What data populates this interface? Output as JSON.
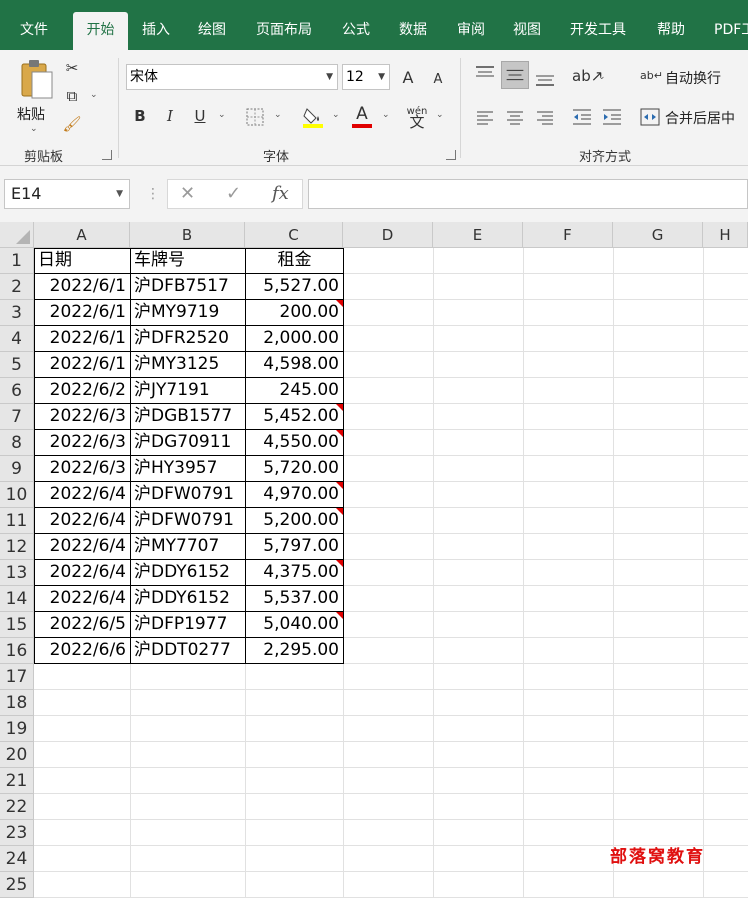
{
  "ribbon_tabs": [
    {
      "label": "文件"
    },
    {
      "label": "开始"
    },
    {
      "label": "插入"
    },
    {
      "label": "绘图"
    },
    {
      "label": "页面布局"
    },
    {
      "label": "公式"
    },
    {
      "label": "数据"
    },
    {
      "label": "审阅"
    },
    {
      "label": "视图"
    },
    {
      "label": "开发工具"
    },
    {
      "label": "帮助"
    },
    {
      "label": "PDF工"
    }
  ],
  "active_tab": "开始",
  "clipboard": {
    "paste_label": "粘贴",
    "group_label": "剪贴板"
  },
  "font": {
    "name": "宋体",
    "size": "12",
    "group_label": "字体",
    "bold": "B",
    "italic": "I",
    "underline": "U",
    "font_color_glyph": "A",
    "phonetic_glyph": "wén",
    "grow_glyph": "A",
    "shrink_glyph": "A"
  },
  "alignment": {
    "wrap_text_label": "自动换行",
    "merge_center_label": "合并后居中",
    "group_label": "对齐方式"
  },
  "formula_bar": {
    "name_box": "E14",
    "fx": "fx",
    "cancel": "✕",
    "enter": "✓",
    "value": ""
  },
  "columns": [
    "A",
    "B",
    "C",
    "D",
    "E",
    "F",
    "G",
    "H"
  ],
  "rows": [
    "1",
    "2",
    "3",
    "4",
    "5",
    "6",
    "7",
    "8",
    "9",
    "10",
    "11",
    "12",
    "13",
    "14",
    "15",
    "16",
    "17",
    "18",
    "19",
    "20",
    "21",
    "22",
    "23",
    "24",
    "25"
  ],
  "table": {
    "headers": [
      "日期",
      "车牌号",
      "租金"
    ],
    "data": [
      {
        "date": "2022/6/1",
        "plate": "沪DFB7517",
        "rent": "5,527.00",
        "comment": false
      },
      {
        "date": "2022/6/1",
        "plate": "沪MY9719",
        "rent": "200.00",
        "comment": true
      },
      {
        "date": "2022/6/1",
        "plate": "沪DFR2520",
        "rent": "2,000.00",
        "comment": false
      },
      {
        "date": "2022/6/1",
        "plate": "沪MY3125",
        "rent": "4,598.00",
        "comment": false
      },
      {
        "date": "2022/6/2",
        "plate": "沪JY7191",
        "rent": "245.00",
        "comment": false
      },
      {
        "date": "2022/6/3",
        "plate": "沪DGB1577",
        "rent": "5,452.00",
        "comment": true
      },
      {
        "date": "2022/6/3",
        "plate": "沪DG70911",
        "rent": "4,550.00",
        "comment": true
      },
      {
        "date": "2022/6/3",
        "plate": "沪HY3957",
        "rent": "5,720.00",
        "comment": false
      },
      {
        "date": "2022/6/4",
        "plate": "沪DFW0791",
        "rent": "4,970.00",
        "comment": true
      },
      {
        "date": "2022/6/4",
        "plate": "沪DFW0791",
        "rent": "5,200.00",
        "comment": true
      },
      {
        "date": "2022/6/4",
        "plate": "沪MY7707",
        "rent": "5,797.00",
        "comment": false
      },
      {
        "date": "2022/6/4",
        "plate": "沪DDY6152",
        "rent": "4,375.00",
        "comment": true
      },
      {
        "date": "2022/6/4",
        "plate": "沪DDY6152",
        "rent": "5,537.00",
        "comment": false
      },
      {
        "date": "2022/6/5",
        "plate": "沪DFP1977",
        "rent": "5,040.00",
        "comment": true
      },
      {
        "date": "2022/6/6",
        "plate": "沪DDT0277",
        "rent": "2,295.00",
        "comment": false
      }
    ]
  },
  "watermark": "部落窝教育",
  "colors": {
    "ribbon_green": "#217346",
    "comment_red": "#e00000",
    "watermark_red": "#e01010"
  }
}
